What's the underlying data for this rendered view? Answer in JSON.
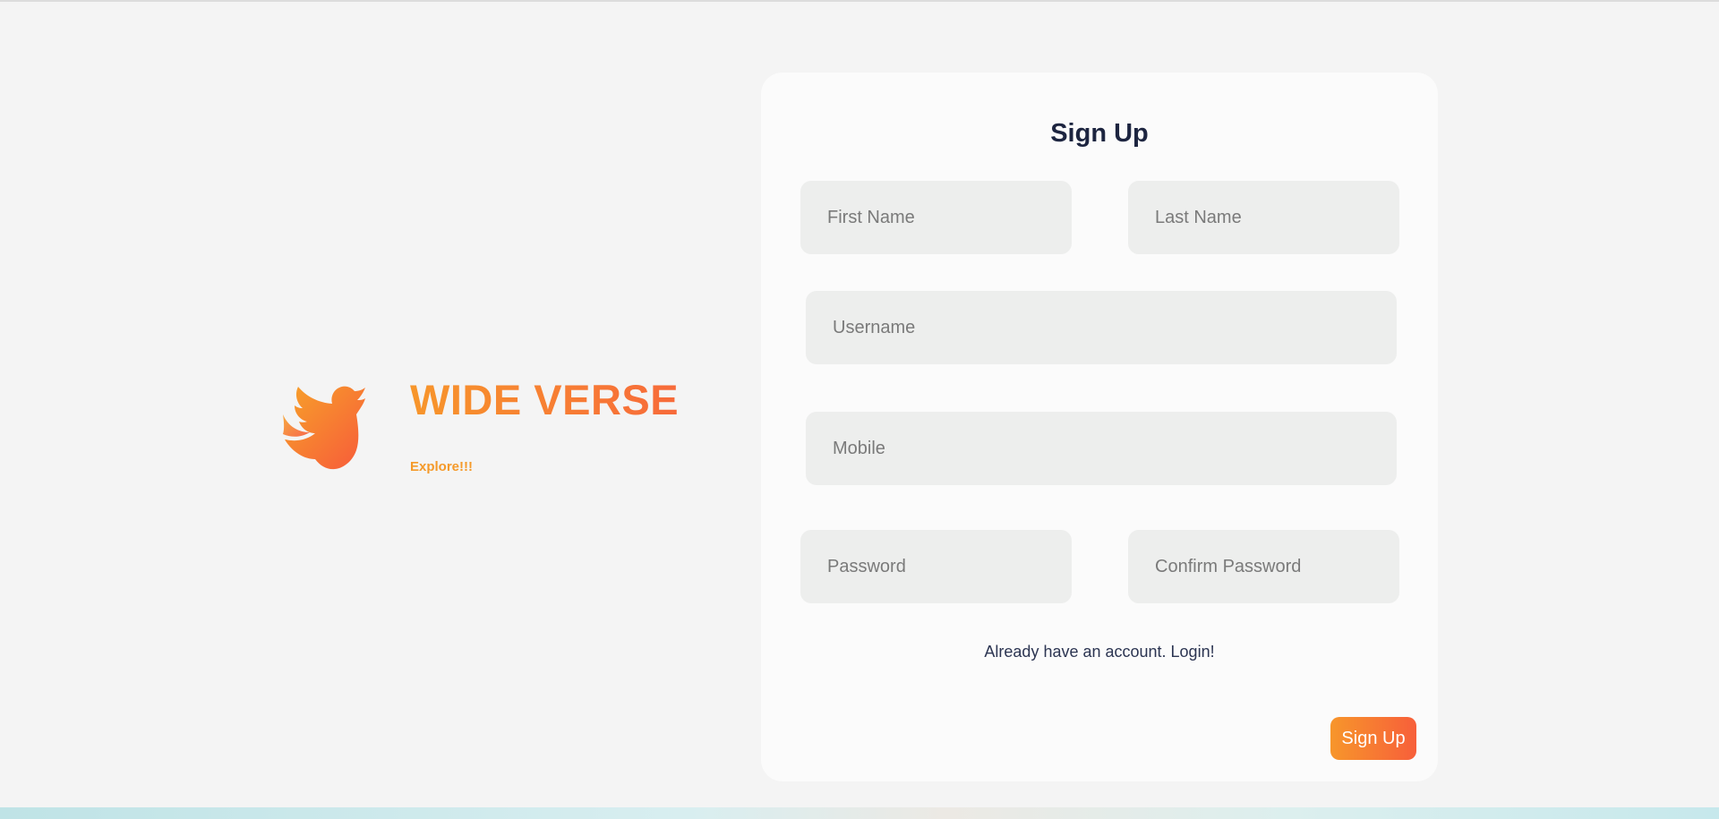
{
  "brand": {
    "logo_icon": "bird-icon",
    "name": "WIDE VERSE",
    "tagline": "Explore!!!",
    "gradient_start": "#f7962b",
    "gradient_end": "#f76a3a"
  },
  "form": {
    "title": "Sign Up",
    "first_name_placeholder": "First Name",
    "last_name_placeholder": "Last Name",
    "username_placeholder": "Username",
    "mobile_placeholder": "Mobile",
    "password_placeholder": "Password",
    "confirm_password_placeholder": "Confirm Password",
    "login_link": "Already have an account. Login!",
    "submit_label": "Sign Up"
  }
}
